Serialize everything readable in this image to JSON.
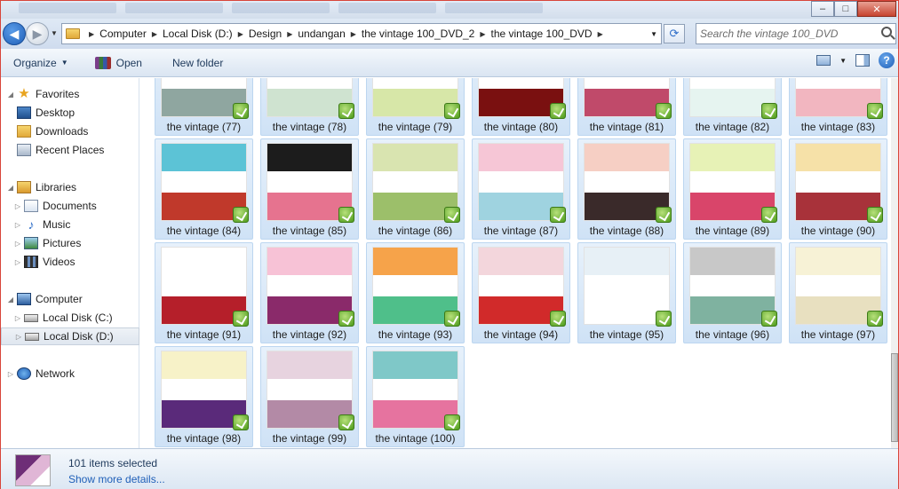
{
  "window": {
    "minimize_glyph": "–",
    "maximize_glyph": "□",
    "close_glyph": "✕"
  },
  "address": {
    "breadcrumbs": [
      "Computer",
      "Local Disk (D:)",
      "Design",
      "undangan",
      "the vintage 100_DVD_2",
      "the vintage 100_DVD"
    ],
    "search_placeholder": "Search the vintage 100_DVD"
  },
  "toolbar": {
    "organize_label": "Organize",
    "open_label": "Open",
    "new_folder_label": "New folder"
  },
  "nav": {
    "favorites": "Favorites",
    "desktop": "Desktop",
    "downloads": "Downloads",
    "recent": "Recent Places",
    "libraries": "Libraries",
    "documents": "Documents",
    "music": "Music",
    "pictures": "Pictures",
    "videos": "Videos",
    "computer": "Computer",
    "drive_c": "Local Disk (C:)",
    "drive_d": "Local Disk (D:)",
    "network": "Network"
  },
  "files": [
    {
      "label": "the vintage (77)",
      "top": "#f3efe6",
      "bot": "#8fa6a0"
    },
    {
      "label": "the vintage (78)",
      "top": "#ffffff",
      "bot": "#cfe3d0"
    },
    {
      "label": "the vintage (79)",
      "top": "#f1d7e6",
      "bot": "#d7e7a8"
    },
    {
      "label": "the vintage (80)",
      "top": "#b22222",
      "bot": "#7a1010"
    },
    {
      "label": "the vintage (81)",
      "top": "#5e2a5a",
      "bot": "#c04a6a"
    },
    {
      "label": "the vintage (82)",
      "top": "#a9d9cf",
      "bot": "#e6f4f0"
    },
    {
      "label": "the vintage (83)",
      "top": "#f4e9d6",
      "bot": "#f2b6c0"
    },
    {
      "label": "the vintage (84)",
      "top": "#5cc3d6",
      "bot": "#c0392b"
    },
    {
      "label": "the vintage (85)",
      "top": "#1c1c1c",
      "bot": "#e6738f"
    },
    {
      "label": "the vintage (86)",
      "top": "#d9e4b0",
      "bot": "#9cbf6a"
    },
    {
      "label": "the vintage (87)",
      "top": "#f6c6d6",
      "bot": "#9fd3e0"
    },
    {
      "label": "the vintage (88)",
      "top": "#f6cfc4",
      "bot": "#3a2a2a"
    },
    {
      "label": "the vintage (89)",
      "top": "#e7f2b6",
      "bot": "#d9456a"
    },
    {
      "label": "the vintage (90)",
      "top": "#f6e1a8",
      "bot": "#a8323a"
    },
    {
      "label": "the vintage (91)",
      "top": "#ffffff",
      "bot": "#b51f2a"
    },
    {
      "label": "the vintage (92)",
      "top": "#f7c2d6",
      "bot": "#8a2a6a"
    },
    {
      "label": "the vintage (93)",
      "top": "#f6a34a",
      "bot": "#4fbf8a"
    },
    {
      "label": "the vintage (94)",
      "top": "#f3d6dc",
      "bot": "#d12a2a"
    },
    {
      "label": "the vintage (95)",
      "top": "#e7f0f6",
      "bot": "#ffffff"
    },
    {
      "label": "the vintage (96)",
      "top": "#c8c8c8",
      "bot": "#7fb2a0"
    },
    {
      "label": "the vintage (97)",
      "top": "#f7f2d6",
      "bot": "#e8e0c0"
    },
    {
      "label": "the vintage (98)",
      "top": "#f7f2c8",
      "bot": "#5a2a7a"
    },
    {
      "label": "the vintage (99)",
      "top": "#e7d3df",
      "bot": "#b38aa6"
    },
    {
      "label": "the vintage (100)",
      "top": "#7fc8c8",
      "bot": "#e6739f"
    }
  ],
  "details": {
    "count": "101 items selected",
    "more": "Show more details..."
  }
}
